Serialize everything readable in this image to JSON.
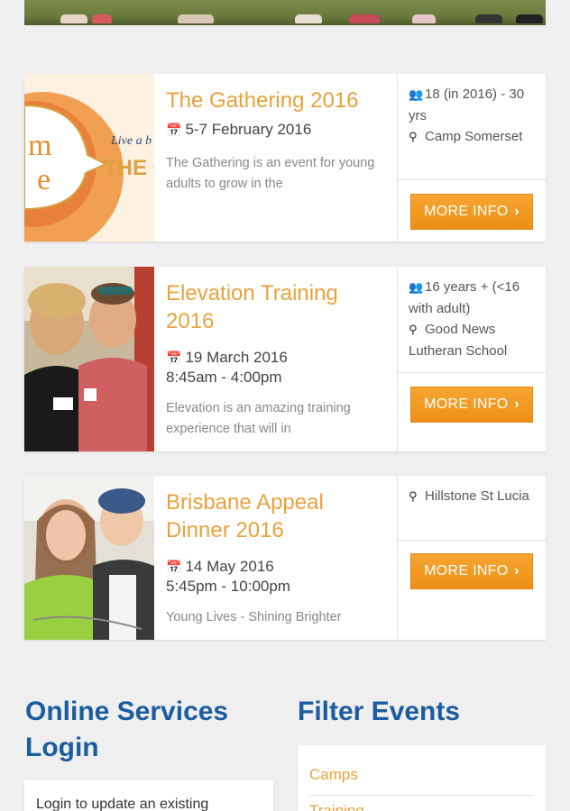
{
  "events": [
    {
      "title": "The Gathering 2016",
      "date_line1": "5-7 February 2016",
      "date_line2": "",
      "description": "The Gathering is an event for young adults to grow in the",
      "age": "18 (in 2016) - 30 yrs",
      "location": "Camp Somerset",
      "button_label": "MORE INFO",
      "image_text_1": "Live a b",
      "image_text_2": "THE G",
      "image_text_3": "m",
      "image_text_4": "e"
    },
    {
      "title": "Elevation Training 2016",
      "date_line1": "19 March 2016",
      "date_line2": "8:45am - 4:00pm",
      "description": "Elevation is an amazing training experience that will in",
      "age": "16 years + (<16 with adult)",
      "location": "Good News Lutheran School",
      "button_label": "MORE INFO"
    },
    {
      "title": "Brisbane Appeal Dinner 2016",
      "date_line1": "14 May 2016",
      "date_line2": "5:45pm - 10:00pm",
      "description": "Young Lives - Shining Brighter",
      "location": "Hillstone St Lucia",
      "button_label": "MORE INFO"
    }
  ],
  "online_services": {
    "heading": "Online Services Login",
    "text": "Login to update an existing"
  },
  "filter_events": {
    "heading": "Filter Events",
    "items": [
      "Camps",
      "Training"
    ]
  },
  "colors": {
    "accent_orange": "#ee8f14",
    "title_orange": "#e8a23c",
    "heading_blue": "#1c5ca0"
  }
}
